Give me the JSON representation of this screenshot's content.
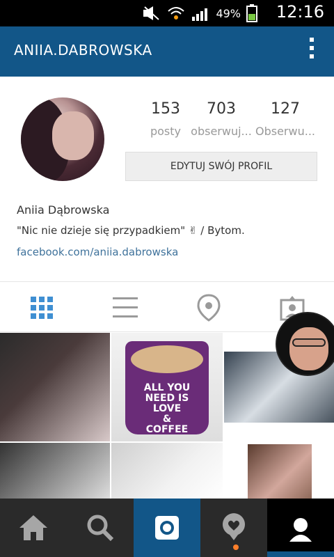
{
  "statusbar": {
    "battery": "49%",
    "time": "12:16",
    "icons": [
      "mute-icon",
      "wifi-icon",
      "signal-icon",
      "battery-icon"
    ]
  },
  "appbar": {
    "title": "ANIIA.DABROWSKA",
    "menu_icon": "overflow-menu-icon"
  },
  "profile": {
    "stats": [
      {
        "value": "153",
        "label": "posty"
      },
      {
        "value": "703",
        "label": "obserwuj..."
      },
      {
        "value": "127",
        "label": "Obserwu..."
      }
    ],
    "edit_button": "EDYTUJ SWÓJ PROFIL",
    "name": "Aniia Dąbrowska",
    "bio": "\"Nic nie dzieje się przypadkiem\" ✌ / Bytom.",
    "link": "facebook.com/aniia.dabrowska"
  },
  "tabs": [
    {
      "name": "grid-icon"
    },
    {
      "name": "list-icon"
    },
    {
      "name": "location-icon"
    },
    {
      "name": "tagged-icon"
    }
  ],
  "grid": {
    "mug_text": [
      "ALL YOU",
      "NEED IS",
      "LOVE",
      "&",
      "COFFEE"
    ]
  },
  "bottomnav": [
    {
      "name": "home-icon"
    },
    {
      "name": "search-icon"
    },
    {
      "name": "camera-icon"
    },
    {
      "name": "activity-icon"
    },
    {
      "name": "profile-icon"
    }
  ],
  "colors": {
    "accent": "#125688",
    "link": "#3f729b",
    "notification": "#ff7f2a"
  }
}
